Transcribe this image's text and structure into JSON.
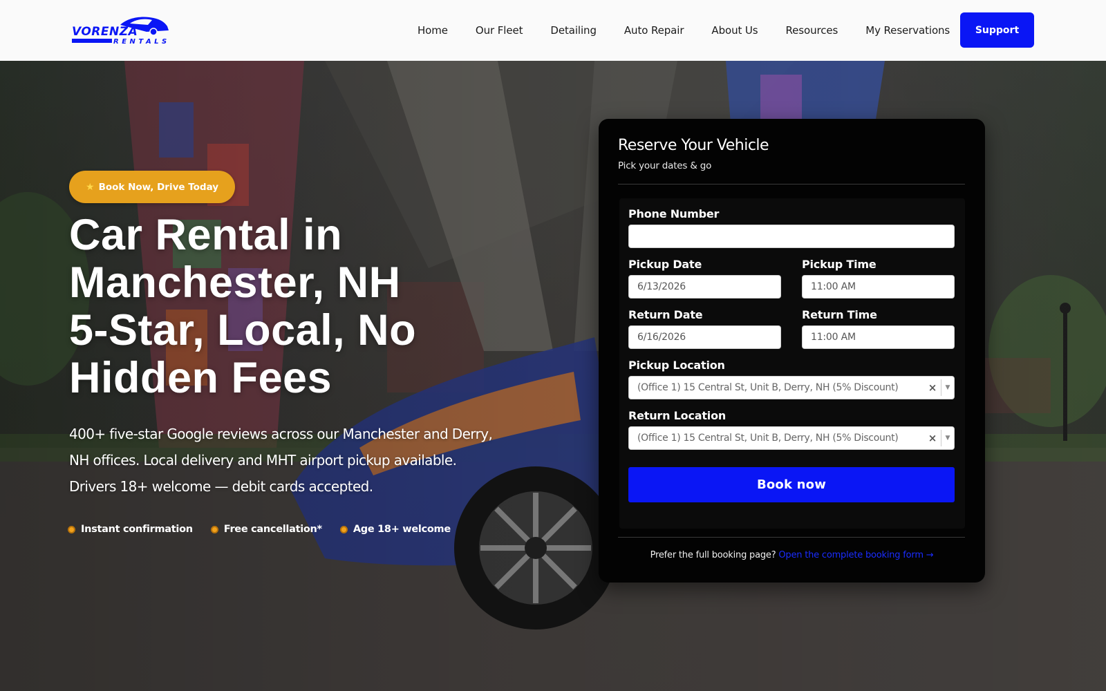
{
  "brand": {
    "logo_top": "VORENZA",
    "logo_bottom": "RENTALS"
  },
  "nav": {
    "items": [
      {
        "label": "Home"
      },
      {
        "label": "Our Fleet"
      },
      {
        "label": "Detailing"
      },
      {
        "label": "Auto Repair"
      },
      {
        "label": "About Us"
      },
      {
        "label": "Resources"
      },
      {
        "label": "My Reservations"
      }
    ],
    "support_label": "Support"
  },
  "hero": {
    "badge": "Book Now, Drive Today",
    "headline_lines": [
      "Car Rental in",
      "Manchester, NH",
      "5-Star, Local, No",
      "Hidden Fees"
    ],
    "subtext_lines": [
      "400+ five-star Google reviews across our Manchester and Derry,",
      "NH offices. Local delivery and MHT airport pickup available.",
      "Drivers 18+ welcome — debit cards accepted."
    ],
    "features": [
      {
        "label": "Instant confirmation"
      },
      {
        "label": "Free cancellation*"
      },
      {
        "label": "Age 18+ welcome"
      }
    ]
  },
  "booking": {
    "title": "Reserve Your Vehicle",
    "subtitle": "Pick your dates & go",
    "phone_label": "Phone Number",
    "phone_value": "",
    "pickup_date_label": "Pickup Date",
    "pickup_date_value": "6/13/2026",
    "pickup_time_label": "Pickup Time",
    "pickup_time_value": "11:00 AM",
    "return_date_label": "Return Date",
    "return_date_value": "6/16/2026",
    "return_time_label": "Return Time",
    "return_time_value": "11:00 AM",
    "pickup_location_label": "Pickup Location",
    "pickup_location_value": "(Office 1) 15 Central St, Unit B, Derry, NH (5% Discount)",
    "return_location_label": "Return Location",
    "return_location_value": "(Office 1) 15 Central St, Unit B, Derry, NH (5% Discount)",
    "book_label": "Book now",
    "footer_text": "Prefer the full booking page?",
    "footer_link": "Open the complete booking form →"
  },
  "colors": {
    "accent_blue": "#0a16f5",
    "badge_orange": "#e6a11d",
    "card_bg": "#030303"
  }
}
